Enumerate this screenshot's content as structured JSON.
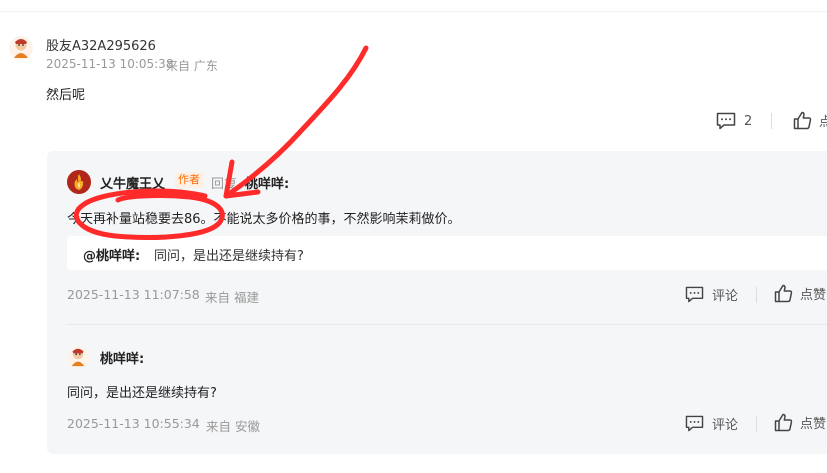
{
  "main_comment": {
    "username": "股友A32A295626",
    "timestamp": "2025-11-13 10:05:38",
    "location": "来自 广东",
    "text": "然后呢",
    "comment_count": "2",
    "like_label": "点"
  },
  "author_reply": {
    "username": "乂牛魔王乂",
    "badge": "作者",
    "reply_word": "回复",
    "reply_target": "桃咩咩:",
    "text": "今天再补量站稳要去86。不能说太多价格的事，不然影响茉莉做价。",
    "quote_user": "@桃咩咩:",
    "quote_text": "同问，是出还是继续持有?",
    "timestamp": "2025-11-13 11:07:58",
    "location": "来自 福建",
    "comment_label": "评论",
    "like_label": "点赞"
  },
  "sub_reply": {
    "username": "桃咩咩:",
    "text": "同问，是出还是继续持有?",
    "timestamp": "2025-11-13 10:55:34",
    "location": "来自 安徽",
    "comment_label": "评论",
    "like_label": "点赞"
  },
  "colors": {
    "annotation_red": "#ff2a2a",
    "author_badge": "#ff6a00",
    "reply_bg": "#f5f6f8"
  }
}
